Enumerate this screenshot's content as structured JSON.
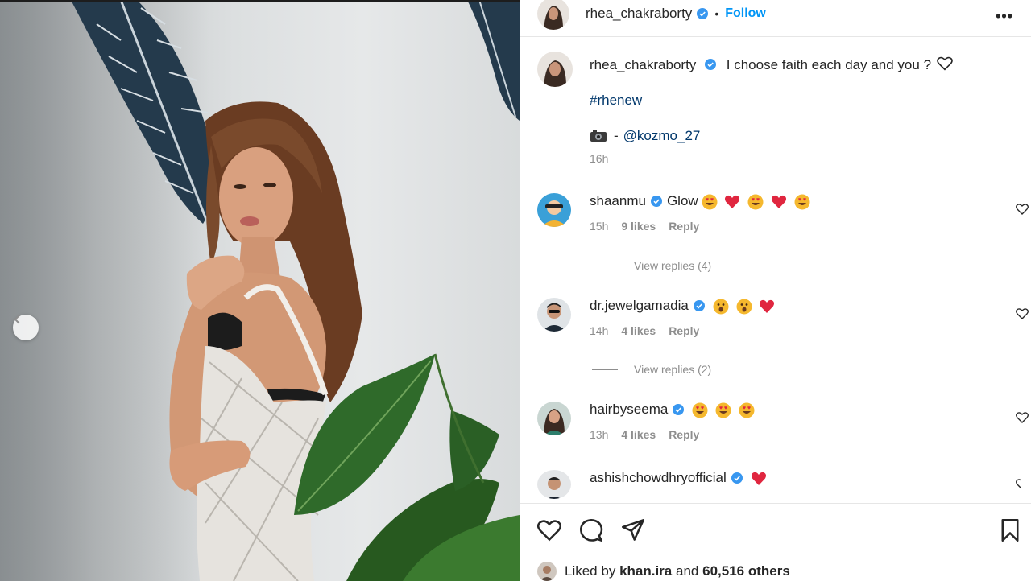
{
  "post": {
    "author": "rhea_chakraborty",
    "follow_label": "Follow",
    "separator": "•",
    "more_label": "•••",
    "caption_text": "I choose faith each day and you ?",
    "hashtag": "#rhenew",
    "credit_dash": "-",
    "credit_mention": "@kozmo_27",
    "caption_time": "16h"
  },
  "comments": [
    {
      "user": "shaanmu",
      "text": "Glow",
      "emojis": [
        "heart-eyes",
        "red-heart",
        "heart-eyes",
        "red-heart",
        "heart-eyes"
      ],
      "time": "15h",
      "likes": "9 likes",
      "reply": "Reply",
      "view_replies": "View replies (4)"
    },
    {
      "user": "dr.jewelgamadia",
      "text": "",
      "emojis": [
        "astonished",
        "astonished",
        "red-heart"
      ],
      "time": "14h",
      "likes": "4 likes",
      "reply": "Reply",
      "view_replies": "View replies (2)"
    },
    {
      "user": "hairbyseema",
      "text": "",
      "emojis": [
        "heart-eyes",
        "heart-eyes",
        "heart-eyes"
      ],
      "time": "13h",
      "likes": "4 likes",
      "reply": "Reply"
    },
    {
      "user": "ashishchowdhryofficial",
      "text": "",
      "emojis": [
        "red-heart"
      ]
    }
  ],
  "liked_by": {
    "prefix": "Liked by",
    "user": "khan.ira",
    "conj": "and",
    "others": "60,516 others"
  },
  "icons": [
    "chevron-left-icon",
    "verified-badge-icon",
    "heart-icon",
    "comment-icon",
    "share-icon",
    "bookmark-icon",
    "camera-emoji"
  ],
  "colors": {
    "link": "#00376b",
    "follow": "#0095f6",
    "verified": "#3897f0",
    "muted": "#8e8e8e"
  }
}
